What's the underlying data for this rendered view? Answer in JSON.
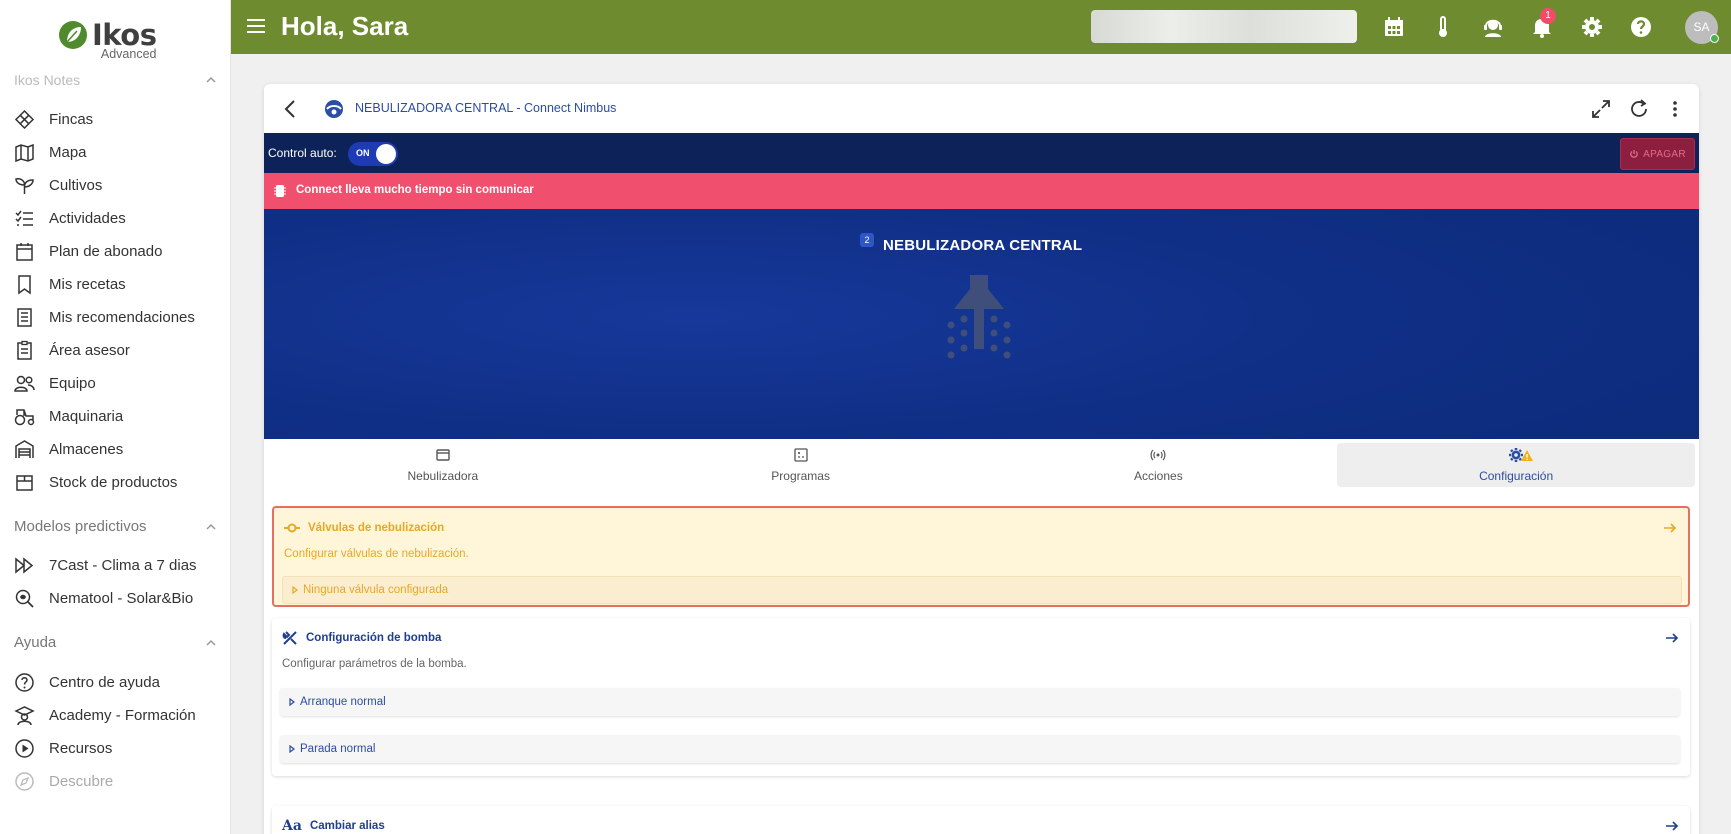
{
  "app": {
    "brand": "Ikos",
    "brand_sub": "Advanced",
    "greeting": "Hola, Sara",
    "notification_count": "1",
    "avatar_initials": "SA"
  },
  "colors": {
    "header_green": "#6e8c2f",
    "alert_red": "#f14f6e",
    "hero_blue": "#0f2f86",
    "valves_yellow": "#e8a823",
    "primary_blue": "#2b4da3"
  },
  "sidebar": {
    "cut_section": "Ikos Notes",
    "items": [
      {
        "label": "Fincas",
        "icon": "diamond-grid-icon"
      },
      {
        "label": "Mapa",
        "icon": "map-icon"
      },
      {
        "label": "Cultivos",
        "icon": "sprout-icon"
      },
      {
        "label": "Actividades",
        "icon": "checklist-icon"
      },
      {
        "label": "Plan de abonado",
        "icon": "calendar-icon"
      },
      {
        "label": "Mis recetas",
        "icon": "bookmark-icon"
      },
      {
        "label": "Mis recomendaciones",
        "icon": "receipt-icon"
      },
      {
        "label": "Área asesor",
        "icon": "clipboard-icon"
      },
      {
        "label": "Equipo",
        "icon": "team-icon"
      },
      {
        "label": "Maquinaria",
        "icon": "tractor-icon"
      },
      {
        "label": "Almacenes",
        "icon": "warehouse-icon"
      },
      {
        "label": "Stock de productos",
        "icon": "box-icon"
      }
    ],
    "section_predictive": "Modelos predictivos",
    "predictive_items": [
      {
        "label": "7Cast - Clima a 7 dias",
        "icon": "fast-forward-icon"
      },
      {
        "label": "Nematool - Solar&Bio",
        "icon": "search-bug-icon"
      }
    ],
    "section_help": "Ayuda",
    "help_items": [
      {
        "label": "Centro de ayuda",
        "icon": "question-circle-icon"
      },
      {
        "label": "Academy - Formación",
        "icon": "graduate-icon"
      },
      {
        "label": "Recursos",
        "icon": "play-circle-icon"
      },
      {
        "label": "Descubre",
        "icon": "compass-icon"
      }
    ]
  },
  "device": {
    "title": "NEBULIZADORA CENTRAL - Connect Nimbus",
    "control_label": "Control auto:",
    "toggle_state": "ON",
    "off_button": "APAGAR",
    "alert": "Connect lleva mucho tiempo sin comunicar",
    "badge": "2",
    "name": "NEBULIZADORA CENTRAL"
  },
  "tabs": [
    {
      "label": "Nebulizadora",
      "icon": "window-icon"
    },
    {
      "label": "Programas",
      "icon": "program-icon"
    },
    {
      "label": "Acciones",
      "icon": "broadcast-icon"
    },
    {
      "label": "Configuración",
      "icon": "gear-icon"
    }
  ],
  "config": {
    "valves": {
      "title": "Válvulas de nebulización",
      "description": "Configurar válvulas de nebulización.",
      "row": "Ninguna válvula configurada"
    },
    "pump": {
      "title": "Configuración de bomba",
      "description": "Configurar parámetros de la bomba.",
      "rows": [
        "Arranque normal",
        "Parada normal"
      ]
    },
    "alias": {
      "title": "Cambiar alias",
      "icon_text": "Aa"
    }
  }
}
